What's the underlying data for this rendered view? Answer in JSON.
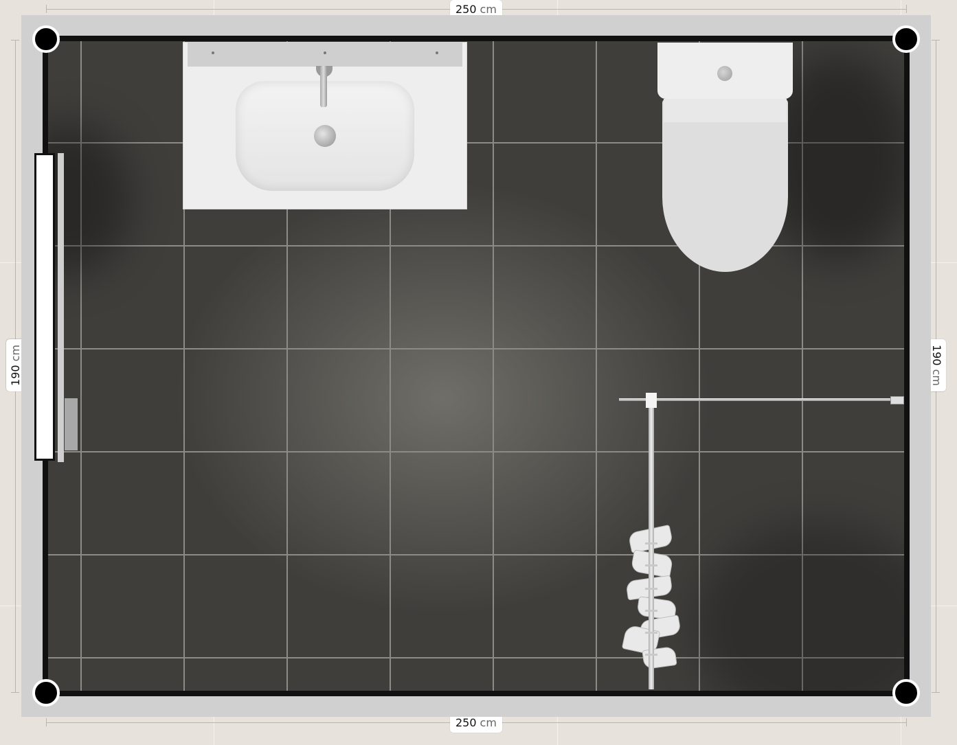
{
  "dimensions": {
    "top": {
      "value": "250",
      "unit": "cm"
    },
    "bottom": {
      "value": "250",
      "unit": "cm"
    },
    "left": {
      "value": "190",
      "unit": "cm"
    },
    "right": {
      "value": "190",
      "unit": "cm"
    }
  },
  "colors": {
    "floor_tile": "#3f3e3b",
    "grout": "#8d8b86",
    "wall": "#d0d0d0",
    "wall_outline": "#111111",
    "background": "#e7e3dc",
    "fixture": "#eeeeee"
  },
  "icons": {
    "corner": "corner-node-icon",
    "door": "door-icon",
    "sink": "washbasin-icon",
    "toilet": "toilet-icon",
    "shower": "shower-curtain-icon"
  }
}
